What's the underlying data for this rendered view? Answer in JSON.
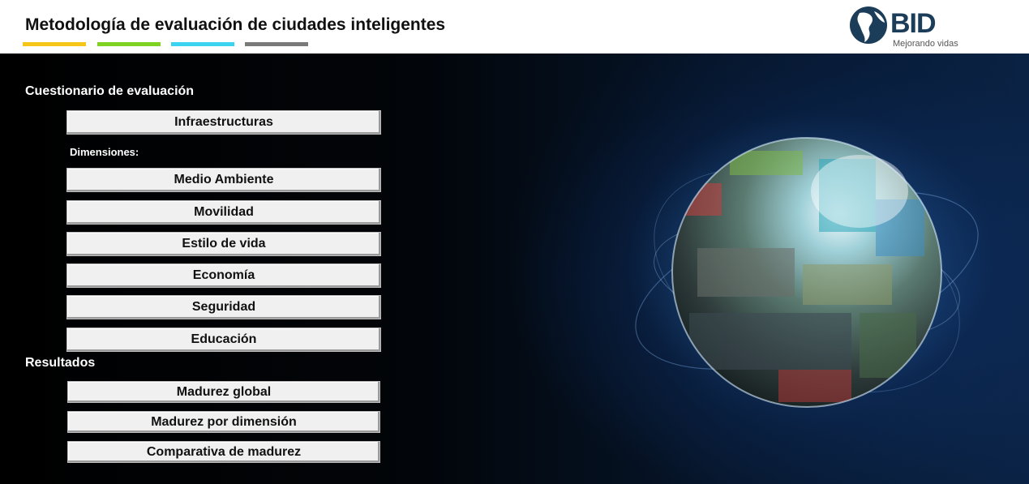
{
  "header": {
    "title": "Metodología de evaluación de ciudades inteligentes",
    "accent_colors": [
      "#f5c518",
      "#7ed321",
      "#3ad3f0",
      "#7a7a7a"
    ],
    "logo": {
      "text": "BID",
      "tagline": "Mejorando vidas"
    }
  },
  "questionnaire": {
    "title": "Cuestionario de evaluación",
    "infra_button": "Infraestructuras",
    "dimensions_label": "Dimensiones:",
    "dimensions": [
      "Medio Ambiente",
      "Movilidad",
      "Estilo de vida",
      "Economía",
      "Seguridad",
      "Educación"
    ]
  },
  "results": {
    "title": "Resultados",
    "buttons": [
      "Madurez global",
      "Madurez por dimensión",
      "Comparativa de madurez"
    ]
  },
  "colors": {
    "button_bg": "#f0f0f0",
    "page_bg": "#000000",
    "header_bg": "#ffffff"
  }
}
